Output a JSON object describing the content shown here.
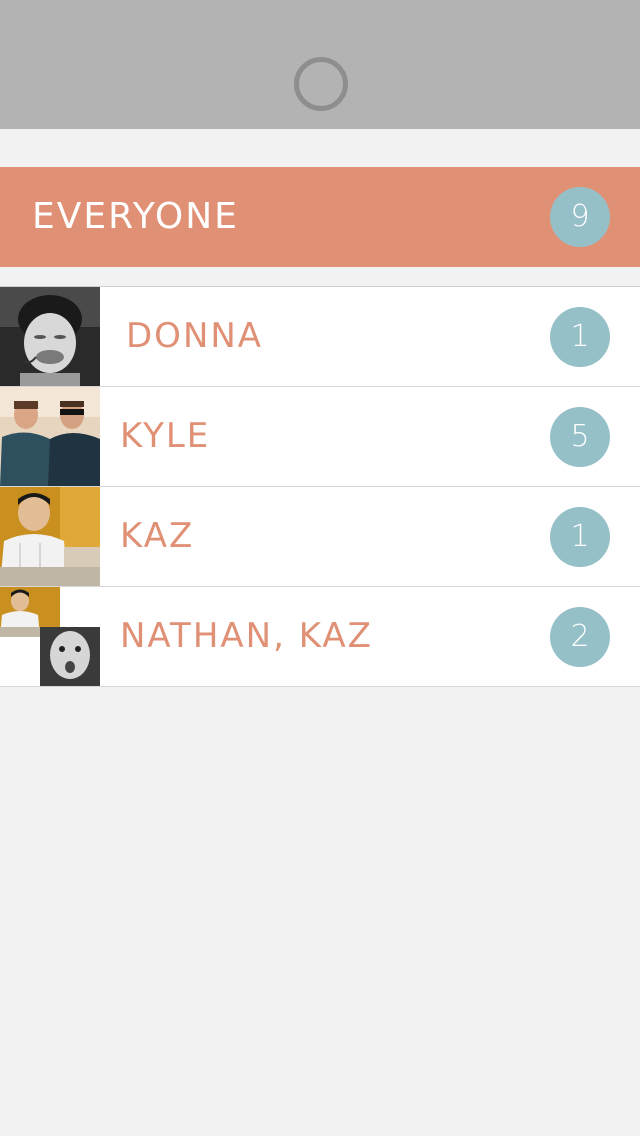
{
  "everyone": {
    "label": "EVERYONE",
    "count": "9"
  },
  "friends": [
    {
      "name": "DONNA",
      "count": "1",
      "avatar": "avatar-donna"
    },
    {
      "name": "KYLE",
      "count": "5",
      "avatar": "avatar-kyle"
    },
    {
      "name": "KAZ",
      "count": "1",
      "avatar": "avatar-kaz"
    },
    {
      "name": "NATHAN, KAZ",
      "count": "2",
      "avatar": "avatar-group-nathan-kaz"
    }
  ],
  "colors": {
    "accent": "#e09075",
    "badge": "#96c0c8",
    "top_bar": "#b3b3b3",
    "background": "#f2f2f2"
  }
}
